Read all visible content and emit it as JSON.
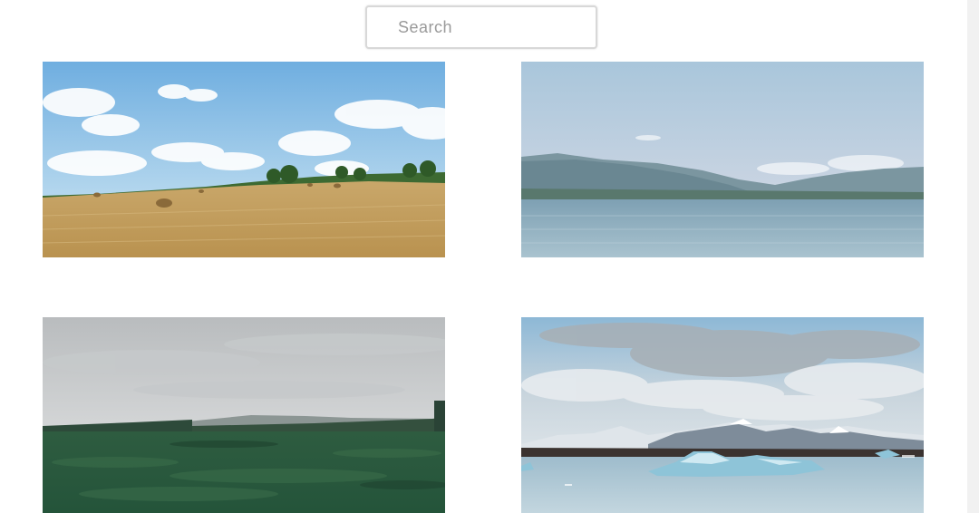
{
  "search": {
    "placeholder": "Search",
    "value": ""
  },
  "gallery": {
    "items": [
      {
        "icon": "hay-field-photo"
      },
      {
        "icon": "lake-mountains-photo"
      },
      {
        "icon": "green-forest-photo"
      },
      {
        "icon": "glacier-lagoon-photo"
      }
    ]
  },
  "colors": {
    "background": "#ffffff",
    "scrollbar": "#f1f1f1",
    "search_border": "#d8d8d8",
    "placeholder": "#9a9a9a"
  }
}
